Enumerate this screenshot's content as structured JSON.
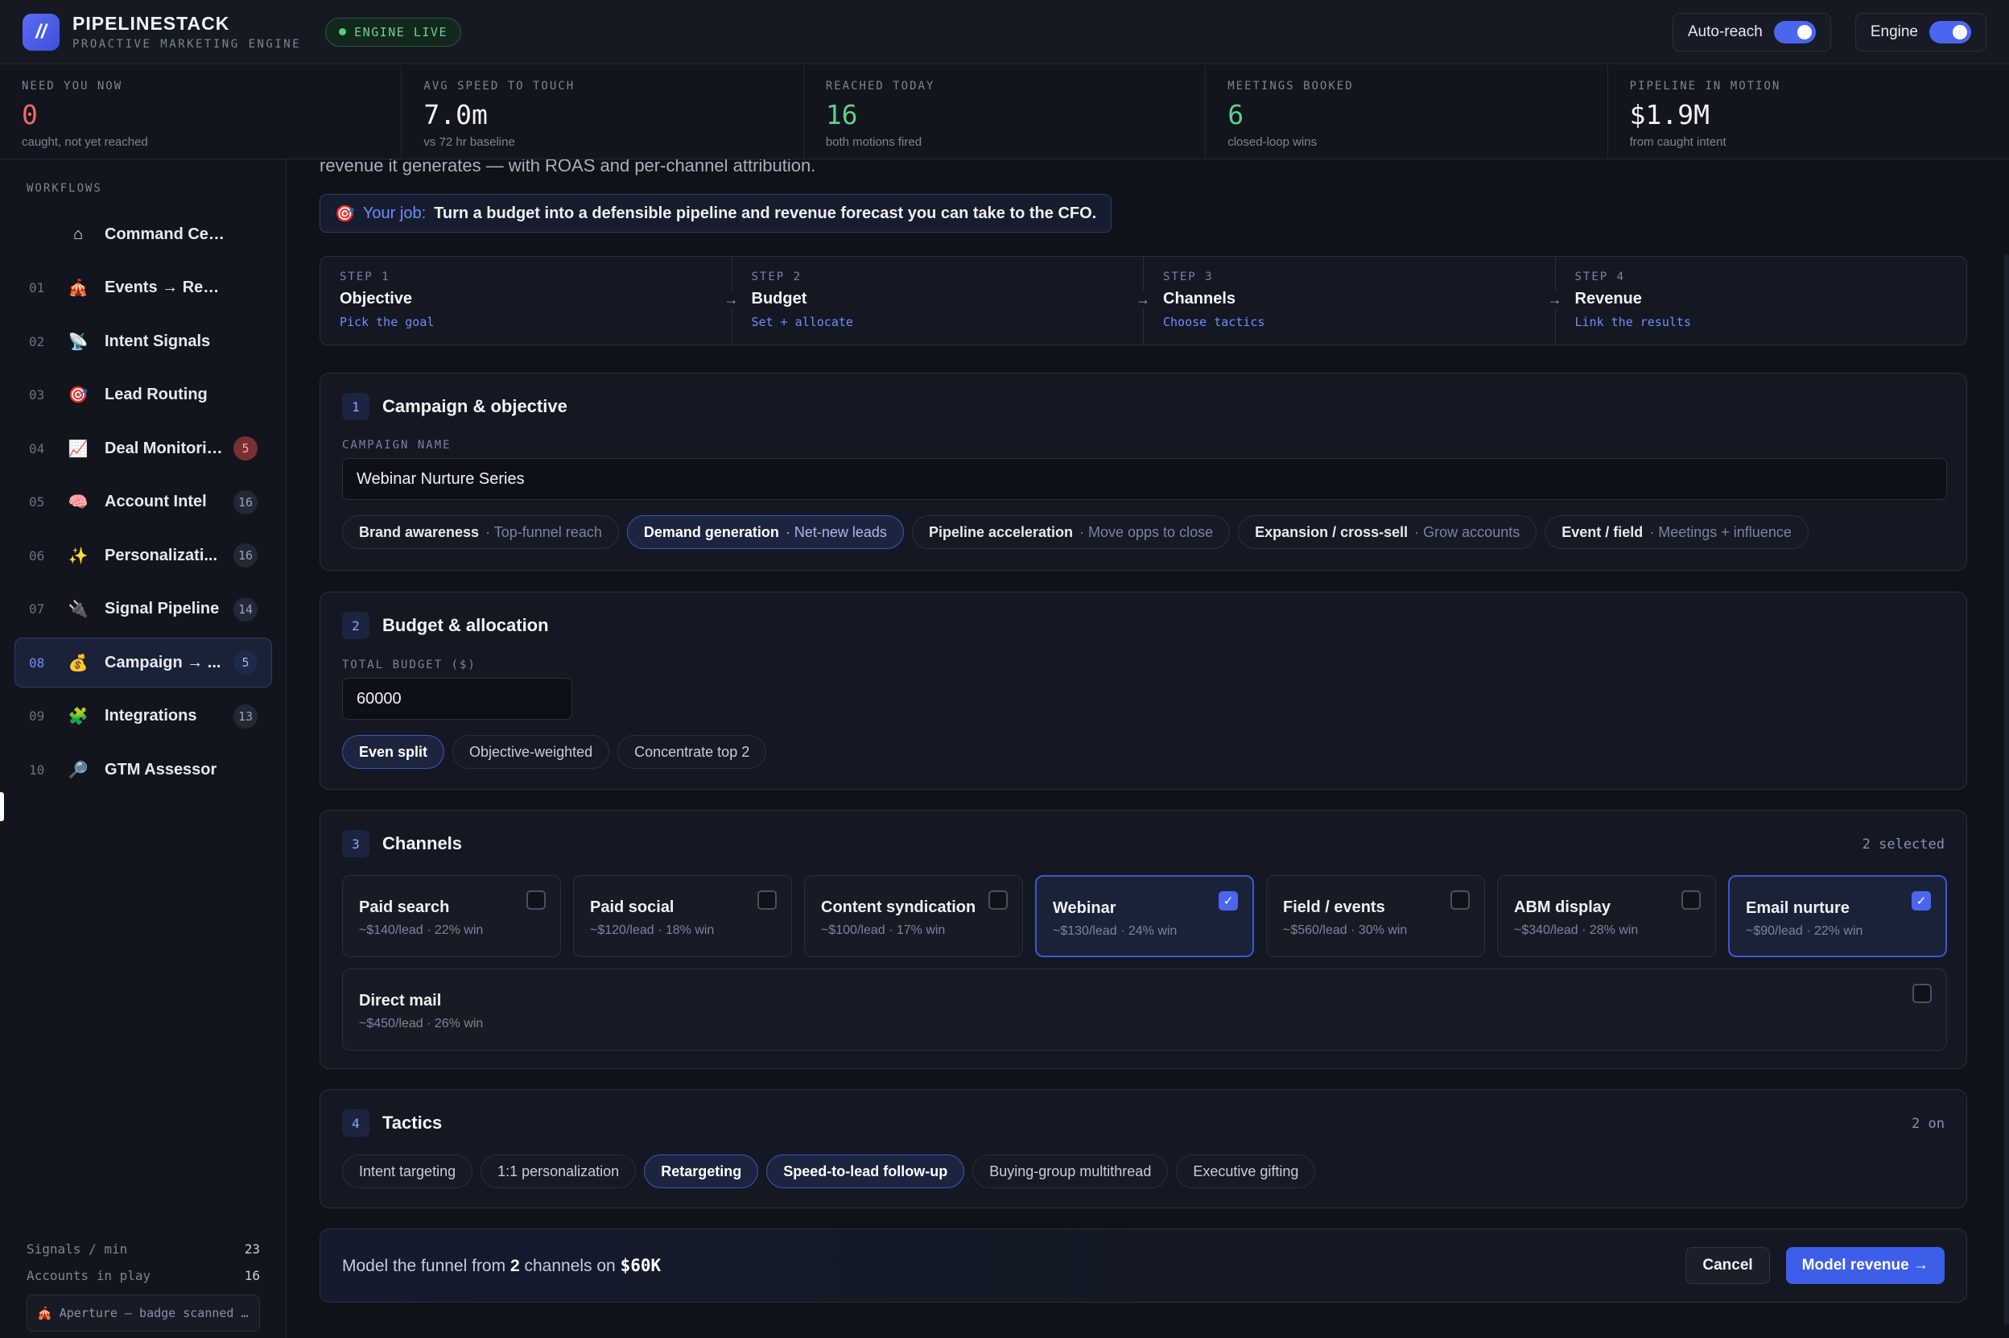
{
  "header": {
    "logo": "//",
    "brand": "PIPELINESTACK",
    "tagline": "PROACTIVE MARKETING ENGINE",
    "status": "ENGINE LIVE",
    "toggles": [
      {
        "label": "Auto-reach"
      },
      {
        "label": "Engine"
      }
    ]
  },
  "stats": [
    {
      "label": "NEED YOU NOW",
      "value": "0",
      "sub": "caught, not yet reached"
    },
    {
      "label": "AVG SPEED TO TOUCH",
      "value": "7.0m",
      "sub": "vs 72 hr baseline"
    },
    {
      "label": "REACHED TODAY",
      "value": "16",
      "sub": "both motions fired"
    },
    {
      "label": "MEETINGS BOOKED",
      "value": "6",
      "sub": "closed-loop wins"
    },
    {
      "label": "PIPELINE IN MOTION",
      "value": "$1.9M",
      "sub": "from caught intent"
    }
  ],
  "sidebar": {
    "title": "WORKFLOWS",
    "items": [
      {
        "num": "",
        "icon": "⌂",
        "label": "Command Center",
        "badge": ""
      },
      {
        "num": "01",
        "icon": "🎪",
        "label": "Events → Revenue",
        "badge": ""
      },
      {
        "num": "02",
        "icon": "📡",
        "label": "Intent Signals",
        "badge": ""
      },
      {
        "num": "03",
        "icon": "🎯",
        "label": "Lead Routing",
        "badge": ""
      },
      {
        "num": "04",
        "icon": "📈",
        "label": "Deal Monitoring",
        "badge": "5"
      },
      {
        "num": "05",
        "icon": "🧠",
        "label": "Account Intel",
        "badge": "16"
      },
      {
        "num": "06",
        "icon": "✨",
        "label": "Personalizati...",
        "badge": "16"
      },
      {
        "num": "07",
        "icon": "🔌",
        "label": "Signal Pipeline",
        "badge": "14"
      },
      {
        "num": "08",
        "icon": "💰",
        "label": "Campaign → ...",
        "badge": "5"
      },
      {
        "num": "09",
        "icon": "🧩",
        "label": "Integrations",
        "badge": "13"
      },
      {
        "num": "10",
        "icon": "🔎",
        "label": "GTM Assessor",
        "badge": ""
      }
    ],
    "footer_stats": [
      {
        "label": "Signals / min",
        "value": "23"
      },
      {
        "label": "Accounts in play",
        "value": "16"
      }
    ],
    "ticker": "🎪 Aperture — badge scanned …"
  },
  "main": {
    "intro": "revenue it generates — with ROAS and per-channel attribution.",
    "job": {
      "icon": "🎯",
      "label": "Your job:",
      "text": "Turn a budget into a defensible pipeline and revenue forecast you can take to the CFO."
    },
    "steps": [
      {
        "k": "STEP 1",
        "t": "Objective",
        "s": "Pick the goal"
      },
      {
        "k": "STEP 2",
        "t": "Budget",
        "s": "Set + allocate"
      },
      {
        "k": "STEP 3",
        "t": "Channels",
        "s": "Choose tactics"
      },
      {
        "k": "STEP 4",
        "t": "Revenue",
        "s": "Link the results"
      }
    ],
    "arrow": "→",
    "campaign": {
      "num": "1",
      "title": "Campaign & objective",
      "field_label": "CAMPAIGN NAME",
      "name": "Webinar Nurture Series",
      "objectives": [
        {
          "t": "Brand awareness",
          "d": "· Top-funnel reach"
        },
        {
          "t": "Demand generation",
          "d": "· Net-new leads"
        },
        {
          "t": "Pipeline acceleration",
          "d": "· Move opps to close"
        },
        {
          "t": "Expansion / cross-sell",
          "d": "· Grow accounts"
        },
        {
          "t": "Event / field",
          "d": "· Meetings + influence"
        }
      ]
    },
    "budget": {
      "num": "2",
      "title": "Budget & allocation",
      "field_label": "TOTAL BUDGET ($)",
      "value": "60000",
      "modes": [
        "Even split",
        "Objective-weighted",
        "Concentrate top 2"
      ]
    },
    "channels": {
      "num": "3",
      "title": "Channels",
      "meta": "2 selected",
      "items": [
        {
          "name": "Paid search",
          "sub": "~$140/lead · 22% win",
          "checked": false
        },
        {
          "name": "Paid social",
          "sub": "~$120/lead · 18% win",
          "checked": false
        },
        {
          "name": "Content syndication",
          "sub": "~$100/lead · 17% win",
          "checked": false
        },
        {
          "name": "Webinar",
          "sub": "~$130/lead · 24% win",
          "checked": true
        },
        {
          "name": "Field / events",
          "sub": "~$560/lead · 30% win",
          "checked": false
        },
        {
          "name": "ABM display",
          "sub": "~$340/lead · 28% win",
          "checked": false
        },
        {
          "name": "Email nurture",
          "sub": "~$90/lead · 22% win",
          "checked": true
        },
        {
          "name": "Direct mail",
          "sub": "~$450/lead · 26% win",
          "checked": false
        }
      ]
    },
    "tactics": {
      "num": "4",
      "title": "Tactics",
      "meta": "2 on",
      "items": [
        "Intent targeting",
        "1:1 personalization",
        "Retargeting",
        "Speed-to-lead follow-up",
        "Buying-group multithread",
        "Executive gifting"
      ]
    },
    "footer": {
      "pre": "Model the funnel from",
      "count": "2",
      "mid": "channels on",
      "budget": "$60K",
      "cancel": "Cancel",
      "primary": "Model revenue →"
    }
  }
}
